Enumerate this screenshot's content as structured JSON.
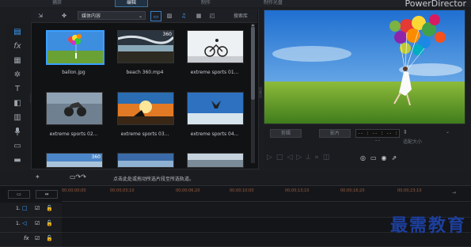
{
  "top_tabs": [
    "捕获",
    "编辑",
    "制作",
    "制作光盘"
  ],
  "brand": "PowerDirector",
  "left_tools": [
    {
      "icon": "media-room-icon",
      "glyph": "▤"
    },
    {
      "icon": "fx-icon",
      "glyph": "fx"
    },
    {
      "icon": "pip-icon",
      "glyph": "▦"
    },
    {
      "icon": "particle-icon",
      "glyph": "✲"
    },
    {
      "icon": "title-icon",
      "glyph": "T"
    },
    {
      "icon": "transition-icon",
      "glyph": "◧"
    },
    {
      "icon": "audio-mix-icon",
      "glyph": "▥"
    },
    {
      "icon": "voice-icon",
      "glyph": "🎤"
    },
    {
      "icon": "chapter-icon",
      "glyph": "▭"
    },
    {
      "icon": "subtitle-icon",
      "glyph": "▬"
    }
  ],
  "library": {
    "filter_label": "媒体内容",
    "search_placeholder": "搜索库",
    "items": [
      {
        "name": "ballon.jpg",
        "scene": "balloon"
      },
      {
        "name": "beach 360.mp4",
        "scene": "beach",
        "badge": "360"
      },
      {
        "name": "extreme sports 01...",
        "scene": "bike"
      },
      {
        "name": "extreme sports 02...",
        "scene": "moto"
      },
      {
        "name": "extreme sports 03...",
        "scene": "sunset"
      },
      {
        "name": "extreme sports 04...",
        "scene": "jump"
      },
      {
        "name": "",
        "scene": "sky",
        "badge": "360"
      },
      {
        "name": "",
        "scene": "sky2"
      },
      {
        "name": "",
        "scene": "sky3"
      }
    ]
  },
  "preview": {
    "mode_clip": "剪辑",
    "mode_movie": "影片",
    "timecode": "-- : -- : -- : --",
    "fit_label": "适配大小"
  },
  "timeline": {
    "hint": "点击此处或拖动所选片段至所选轨道。",
    "ticks": [
      "00;00;00;00",
      "00;00;03;10",
      "00;00;06;20",
      "00;00;10;00",
      "00;00;13;10",
      "00;00;16;20",
      "00;00;20;00",
      "00;00;23;10",
      "00;00;26;20",
      "00;00;30;00",
      "00;00;33;10"
    ],
    "tracks": [
      {
        "label": "1.",
        "icon": "video-track-icon",
        "glyph": "□"
      },
      {
        "label": "1.",
        "icon": "audio-track-icon",
        "glyph": "◁"
      },
      {
        "label": "fx",
        "icon": "fx-track-icon",
        "glyph": ""
      }
    ]
  },
  "watermark": "最需教育"
}
